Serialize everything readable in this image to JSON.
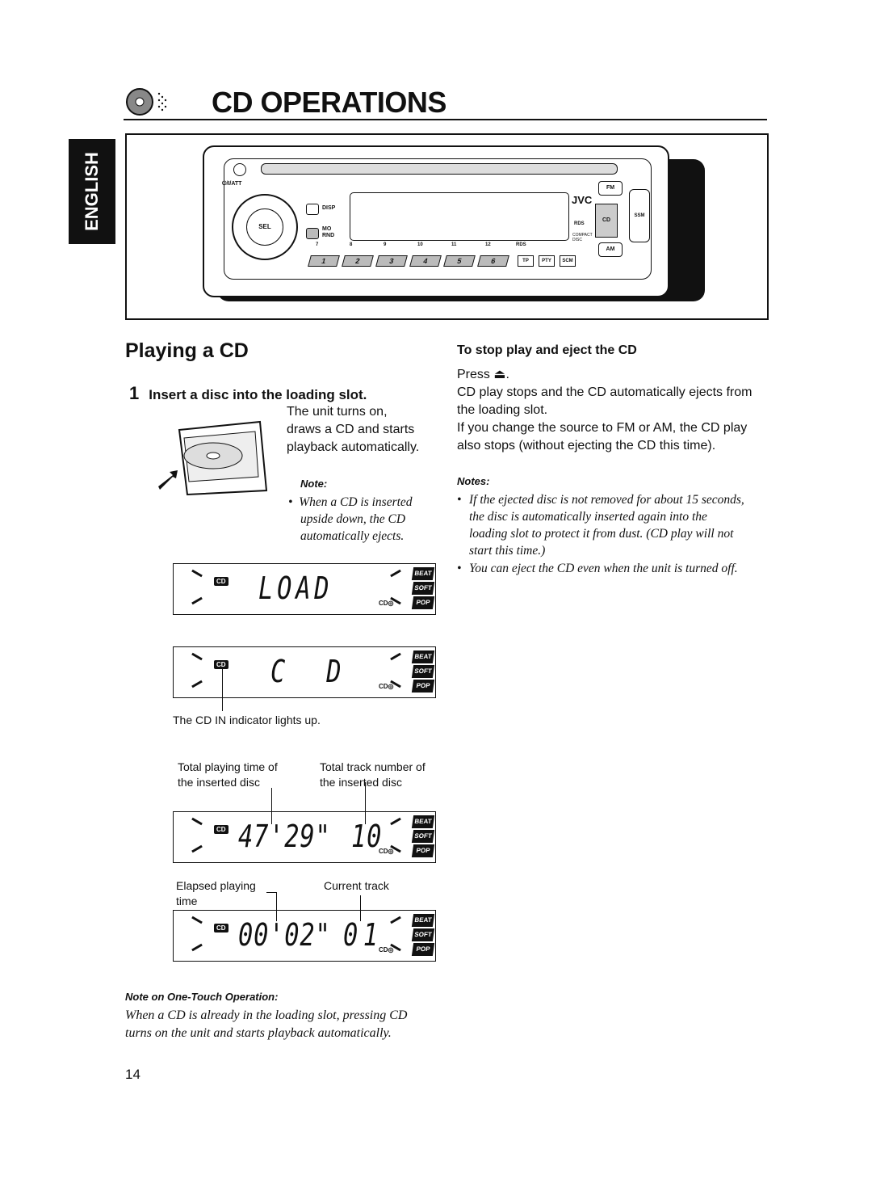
{
  "header": {
    "title": "CD OPERATIONS",
    "icon": "cd-disc-icon"
  },
  "side_tab": {
    "language": "ENGLISH"
  },
  "device": {
    "brand": "JVC",
    "buttons": {
      "power": "⏻/I/ATT",
      "disp": "DISP",
      "mo_rnd": [
        "MO",
        "RND"
      ],
      "sel": "SEL",
      "fm": "FM",
      "cd": "CD",
      "am": "AM",
      "ssm": "SSM",
      "presets": [
        "1",
        "2",
        "3",
        "4",
        "5",
        "6"
      ],
      "preset_alt": [
        "7",
        "8",
        "9",
        "10",
        "11",
        "12"
      ],
      "rds": "RDS",
      "tp": "TP",
      "pty": "PTY",
      "scm": "SCM"
    },
    "logos": [
      "RDS",
      "COMPACT DISC"
    ]
  },
  "section": {
    "title": "Playing a CD"
  },
  "step1": {
    "number": "1",
    "title": "Insert a disc into the loading slot.",
    "text": [
      "The unit turns on,",
      "draws a CD and starts",
      "playback automatically."
    ],
    "note_heading": "Note:",
    "note": "When a CD is inserted upside down, the CD automatically ejects."
  },
  "displays": [
    {
      "main": "LOAD",
      "track": "",
      "indicator": "CD",
      "modes": [
        "BEAT",
        "SOFT",
        "POP"
      ]
    },
    {
      "main": "C  D",
      "track": "",
      "indicator": "CD",
      "modes": [
        "BEAT",
        "SOFT",
        "POP"
      ]
    },
    {
      "main": "47'29\"",
      "track": "10",
      "indicator": "CD",
      "modes": [
        "BEAT",
        "SOFT",
        "POP"
      ]
    },
    {
      "main": "00'02\"",
      "track": "01",
      "indicator": "CD",
      "modes": [
        "BEAT",
        "SOFT",
        "POP"
      ]
    }
  ],
  "captions": {
    "cd_in": "The CD IN indicator lights up.",
    "total_time": [
      "Total playing time of",
      "the inserted disc"
    ],
    "total_tracks": [
      "Total track number of",
      "the inserted disc"
    ],
    "elapsed": [
      "Elapsed playing",
      "time"
    ],
    "current_track": "Current track"
  },
  "one_touch": {
    "heading": "Note on One-Touch Operation:",
    "text": [
      "When a CD is already in the loading slot, pressing CD",
      "turns on the unit and starts playback automatically."
    ]
  },
  "stop": {
    "heading": "To stop play and eject the CD",
    "press": "Press ⏏.",
    "text": [
      "CD play stops and the CD automatically ejects from",
      "the loading slot.",
      "If you change the source to FM or AM, the CD play",
      "also stops (without ejecting the CD this time)."
    ]
  },
  "notes": {
    "heading": "Notes:",
    "items": [
      [
        "If the ejected disc is not removed for about 15 seconds,",
        "the disc is automatically inserted again into the",
        "loading slot to protect it from dust. (CD play will not",
        "start this time.)"
      ],
      [
        "You can eject the CD even when the unit is turned off."
      ]
    ]
  },
  "page_number": "14"
}
